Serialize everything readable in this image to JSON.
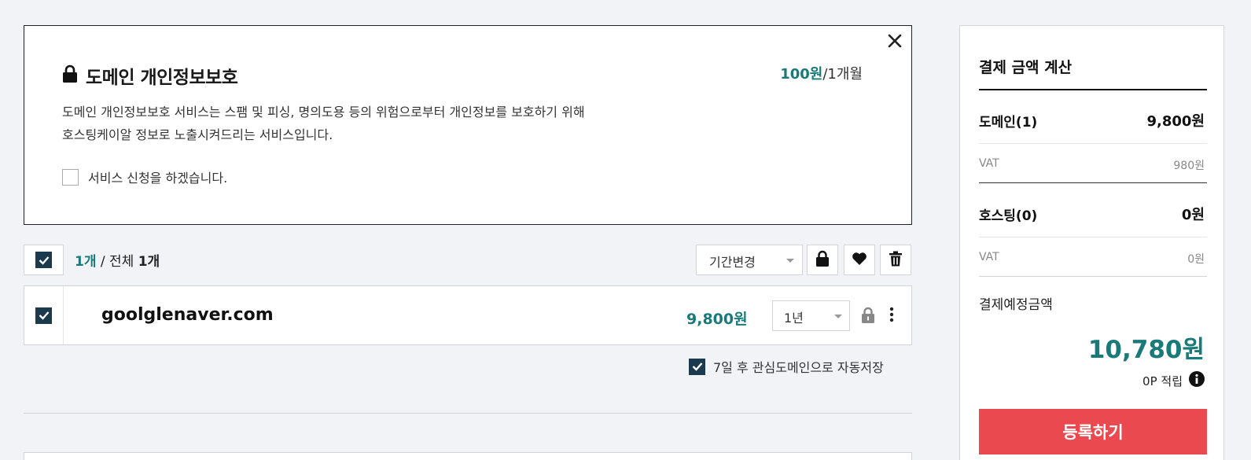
{
  "promo": {
    "title": "도메인 개인정보보호",
    "price_amount": "100원",
    "price_unit": "/1개월",
    "description_line1": "도메인 개인정보보호 서비스는 스팸 및 피싱, 명의도용 등의 위험으로부터 개인정보를 보호하기 위해",
    "description_line2": "호스팅케이알 정보로 노출시켜드리는 서비스입니다.",
    "consent_label": "서비스 신청을 하겠습니다.",
    "consent_checked": false
  },
  "toolbar": {
    "selected_count": "1개",
    "separator": " / 전체 ",
    "total_count": "1개",
    "period_select": "기간변경"
  },
  "domain_row": {
    "name": "goolglenaver.com",
    "price": "9,800원",
    "period": "1년",
    "checked": true
  },
  "autosave_label": "7일 후 관심도메인으로 자동저장",
  "summary": {
    "title": "결제 금액 계산",
    "domain_label": "도메인(1)",
    "domain_value": "9,800원",
    "domain_vat_label": "VAT",
    "domain_vat_value": "980원",
    "hosting_label": "호스팅(0)",
    "hosting_value": "0원",
    "hosting_vat_label": "VAT",
    "hosting_vat_value": "0원",
    "total_label": "결제예정금액",
    "total_value": "10,780원",
    "points": "0P 적립",
    "register_button": "등록하기"
  },
  "colors": {
    "accent_teal": "#1a7a7a",
    "checkbox_navy": "#1b3a4d",
    "register_red": "#ea4a4f"
  }
}
